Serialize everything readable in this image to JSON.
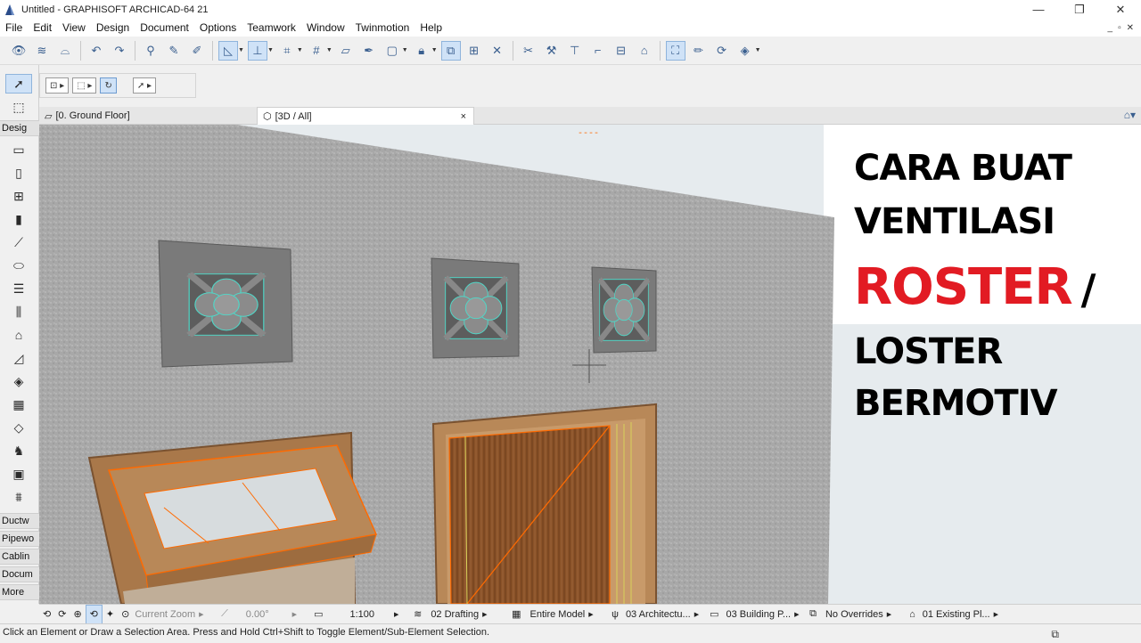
{
  "window": {
    "title": "Untitled - GRAPHISOFT ARCHICAD-64 21",
    "minimize": "—",
    "restore": "❐",
    "close": "✕"
  },
  "menu": [
    "File",
    "Edit",
    "View",
    "Design",
    "Document",
    "Options",
    "Teamwork",
    "Window",
    "Twinmotion",
    "Help"
  ],
  "doc_controls": {
    "minimize": "_",
    "restore": "▫",
    "close": "✕"
  },
  "toolbox": {
    "headers": [
      "Desig",
      "Ductw",
      "Pipewo",
      "Cablin",
      "Docum",
      "More"
    ]
  },
  "tabs": [
    {
      "label": "[0. Ground Floor]",
      "icon": "floor-plan-icon"
    },
    {
      "label": "[3D / All]",
      "icon": "3d-view-icon",
      "close": "×"
    }
  ],
  "viewport": {
    "marker": "----",
    "colors": {
      "wall": "#a9a9a9",
      "wood": "#8a5a34",
      "selection": "#ff6a00",
      "roster_edge": "#4fd8c8",
      "caption_red": "#e21b23"
    }
  },
  "caption": {
    "line1": "CARA BUAT",
    "line2": "VENTILASI",
    "line3": "ROSTER",
    "slash": "/",
    "line4": "LOSTER",
    "line5": "BERMOTIV"
  },
  "status": {
    "zoom": "Current Zoom",
    "angle": "0.00°",
    "scale": "1:100",
    "layer_combo": "02 Drafting",
    "model": "Entire Model",
    "pen_set": "03 Architectu...",
    "mvo": "03 Building P...",
    "overrides": "No Overrides",
    "renovation": "01 Existing Pl..."
  },
  "hint": "Click an Element or Draw a Selection Area. Press and Hold Ctrl+Shift to Toggle Element/Sub-Element Selection."
}
